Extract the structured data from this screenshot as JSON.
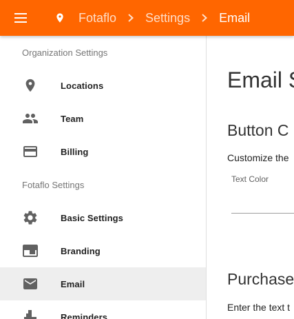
{
  "topbar": {
    "menu_icon": "menu-icon",
    "location_icon": "location-pin-icon",
    "breadcrumb": [
      "Fotaflo",
      "Settings",
      "Email"
    ],
    "separator_icon": "chevron-right-icon",
    "color": "#ff6600"
  },
  "sidebar": {
    "sections": [
      {
        "heading": "Organization Settings",
        "items": [
          {
            "label": "Locations",
            "icon": "location-pin-icon"
          },
          {
            "label": "Team",
            "icon": "people-icon"
          },
          {
            "label": "Billing",
            "icon": "credit-card-icon"
          }
        ]
      },
      {
        "heading": "Fotaflo Settings",
        "items": [
          {
            "label": "Basic Settings",
            "icon": "gear-icon"
          },
          {
            "label": "Branding",
            "icon": "branding-icon"
          },
          {
            "label": "Email",
            "icon": "envelope-icon",
            "selected": true
          },
          {
            "label": "Reminders",
            "icon": "reminders-icon"
          }
        ]
      }
    ]
  },
  "main": {
    "title": "Email S",
    "button_section": {
      "title": "Button C",
      "description": "Customize the",
      "text_color_label": "Text Color",
      "text_color_value": ""
    },
    "purchase_section": {
      "title": "Purchase",
      "description": "Enter the text t"
    }
  }
}
